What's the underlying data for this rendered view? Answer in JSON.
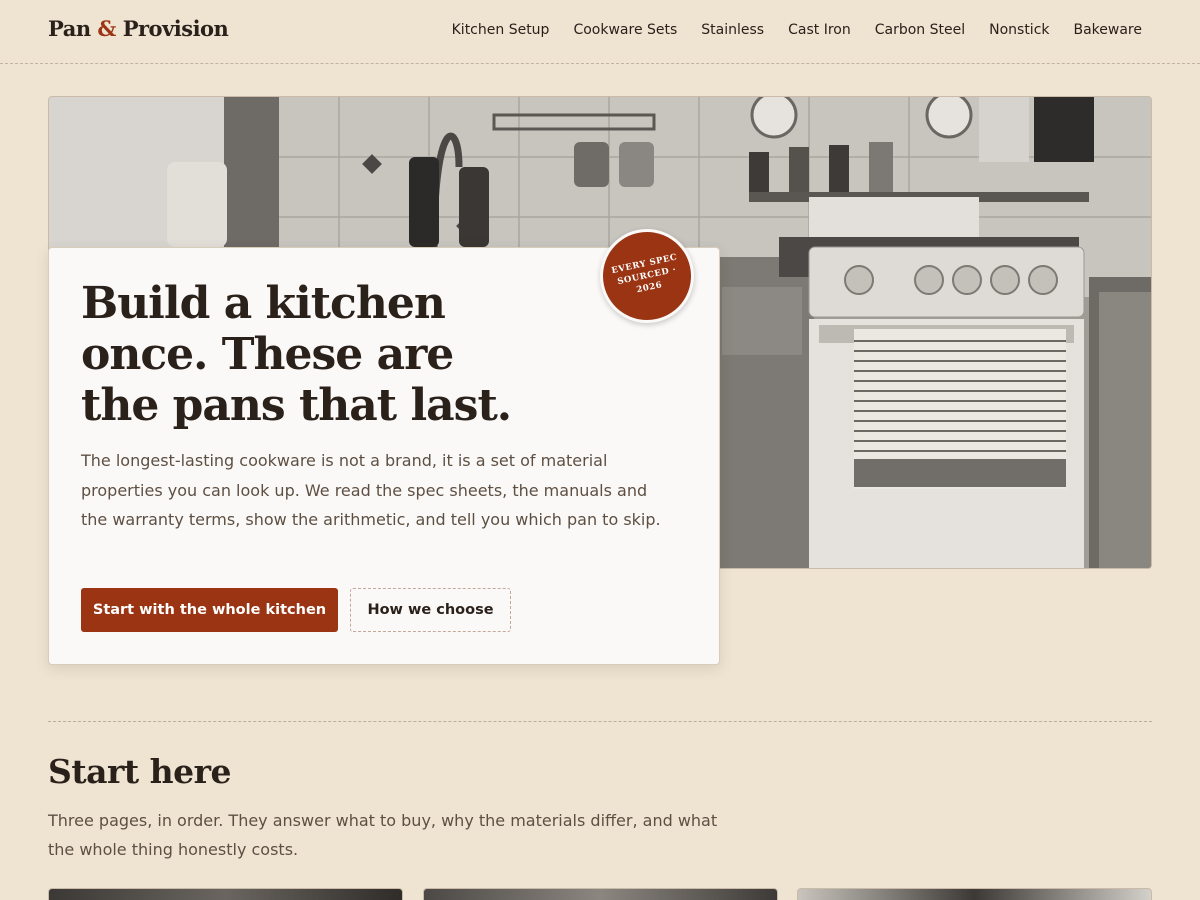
{
  "header": {
    "logo_part1": "Pan",
    "logo_amp": "&",
    "logo_part2": "Provision",
    "nav": [
      {
        "label": "Kitchen Setup"
      },
      {
        "label": "Cookware Sets"
      },
      {
        "label": "Stainless"
      },
      {
        "label": "Cast Iron"
      },
      {
        "label": "Carbon Steel"
      },
      {
        "label": "Nonstick"
      },
      {
        "label": "Bakeware"
      }
    ]
  },
  "hero": {
    "title": "Build a kitchen once. These are the pans that last.",
    "text": "The longest-lasting cookware is not a brand, it is a set of material properties you can look up. We read the spec sheets, the manuals and the warranty terms, show the arithmetic, and tell you which pan to skip.",
    "primary_button": "Start with the whole kitchen",
    "secondary_button": "How we choose",
    "badge": "EVERY SPEC SOURCED · 2026"
  },
  "start_here": {
    "title": "Start here",
    "text": "Three pages, in order. They answer what to buy, why the materials differ, and what the whole thing honestly costs."
  },
  "colors": {
    "background": "#efe4d2",
    "accent": "#9a3412",
    "text": "#2b211b",
    "muted_text": "#5d4f43"
  }
}
